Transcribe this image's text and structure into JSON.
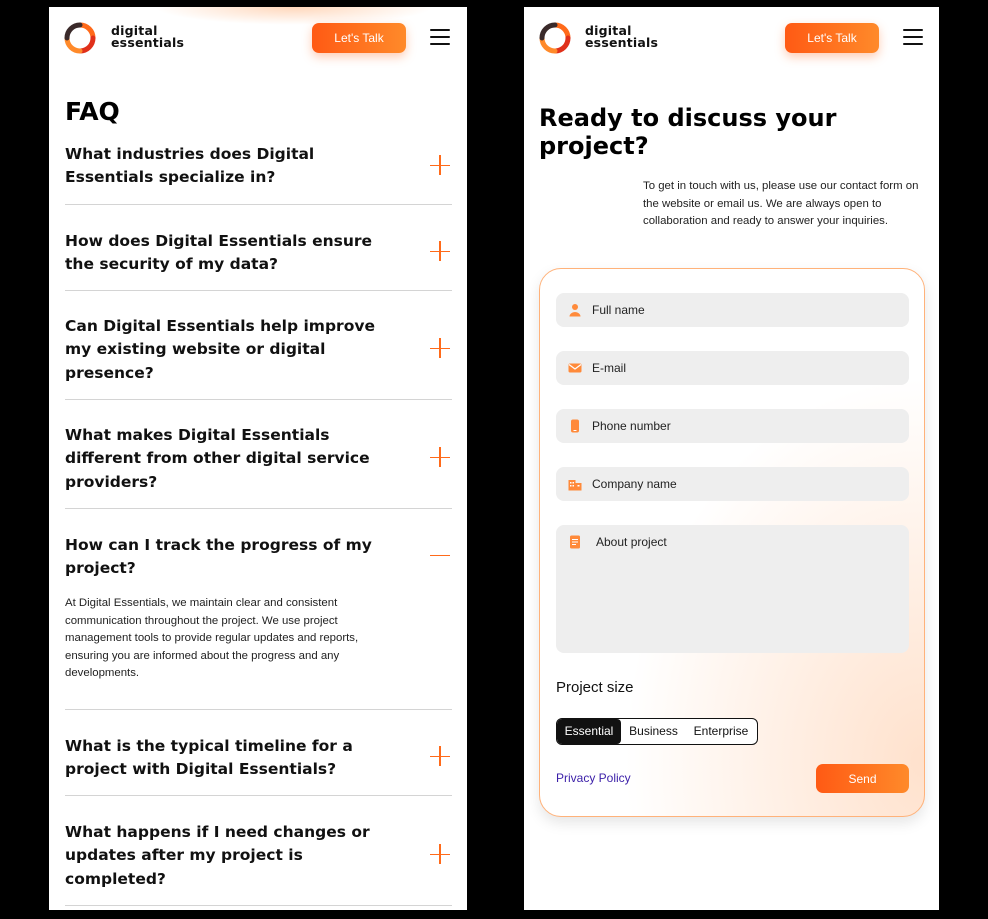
{
  "brand": {
    "line1": "digital",
    "line2": "essentials"
  },
  "header": {
    "cta_label": "Let's Talk"
  },
  "faq": {
    "title": "FAQ",
    "items": [
      {
        "question": "What industries does Digital Essentials specialize in?",
        "expanded": false
      },
      {
        "question": "How does Digital Essentials ensure the security of my data?",
        "expanded": false
      },
      {
        "question": "Can Digital Essentials help improve my existing website or digital presence?",
        "expanded": false
      },
      {
        "question": "What makes Digital Essentials different from other digital service providers?",
        "expanded": false
      },
      {
        "question": "How can I track the progress of my project?",
        "expanded": true,
        "answer": "At Digital Essentials, we maintain clear and consistent communication throughout the project. We use project management tools to provide regular updates and reports, ensuring you are informed about the progress and any developments."
      },
      {
        "question": "What is the typical timeline for a project with Digital Essentials?",
        "expanded": false
      },
      {
        "question": "What happens if I need changes or updates after my project is completed?",
        "expanded": false
      }
    ]
  },
  "contact": {
    "title": "Ready to discuss your project?",
    "description": "To get in touch with us, please use our contact form on the website or email us. We are always open to collaboration and ready to answer your inquiries.",
    "fields": [
      {
        "placeholder": "Full name",
        "icon": "person-icon"
      },
      {
        "placeholder": "E-mail",
        "icon": "mail-icon"
      },
      {
        "placeholder": "Phone number",
        "icon": "phone-icon"
      },
      {
        "placeholder": "Company name",
        "icon": "building-icon"
      },
      {
        "placeholder": "About project",
        "icon": "document-icon"
      }
    ],
    "project_size_label": "Project size",
    "project_sizes": [
      "Essential",
      "Business",
      "Enterprise"
    ],
    "selected_size": "Essential",
    "privacy_label": "Privacy Policy",
    "send_label": "Send"
  },
  "colors": {
    "accent": "#ff6a1a",
    "accent_light": "#ff8a2a",
    "link": "#3a1ea8",
    "field_bg": "#eeeeee"
  }
}
